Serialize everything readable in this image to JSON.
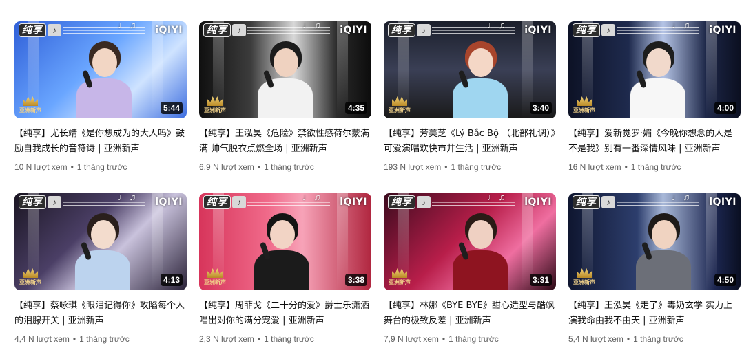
{
  "overlay": {
    "badge_text": "纯享",
    "logo_text": "iQIYI",
    "show_logo_text": "亚洲新声"
  },
  "colors": {
    "text_primary": "#0f0f0f",
    "text_secondary": "#606060",
    "duration_bg": "#000000cc"
  },
  "videos": [
    {
      "title": "【纯享】尤长靖《是你想成为的大人吗》鼓励自我成长的音符诗 | 亚洲新声",
      "duration": "5:44",
      "views": "10 N lượt xem",
      "age": "1 tháng trước"
    },
    {
      "title": "【纯享】王泓昊《危险》禁欲性感荷尔蒙满满 帅气脱衣点燃全场 | 亚洲新声",
      "duration": "4:35",
      "views": "6,9 N lượt xem",
      "age": "1 tháng trước"
    },
    {
      "title": "【纯享】芳美芝《Lý Bắc Bộ （北部礼调）》可爱演唱欢快市井生活 | 亚洲新声",
      "duration": "3:40",
      "views": "193 N lượt xem",
      "age": "1 tháng trước"
    },
    {
      "title": "【纯享】爱新觉罗·媚《今晚你想念的人是不是我》别有一番深情风味 | 亚洲新声",
      "duration": "4:00",
      "views": "16 N lượt xem",
      "age": "1 tháng trước"
    },
    {
      "title": "【纯享】蔡咏琪《眼泪记得你》攻陷每个人的泪腺开关 | 亚洲新声",
      "duration": "4:13",
      "views": "4,4 N lượt xem",
      "age": "1 tháng trước"
    },
    {
      "title": "【纯享】周菲戈《二十分的爱》爵士乐潇洒唱出对你的满分宠爱 | 亚洲新声",
      "duration": "3:38",
      "views": "2,3 N lượt xem",
      "age": "1 tháng trước"
    },
    {
      "title": "【纯享】林娜《BYE BYE》甜心造型与酷飒舞台的极致反差 | 亚洲新声",
      "duration": "3:31",
      "views": "7,9 N lượt xem",
      "age": "1 tháng trước"
    },
    {
      "title": "【纯享】王泓昊《走了》毒奶玄学 实力上演我命由我不由天 | 亚洲新声",
      "duration": "4:50",
      "views": "5,4 N lượt xem",
      "age": "1 tháng trước"
    }
  ]
}
